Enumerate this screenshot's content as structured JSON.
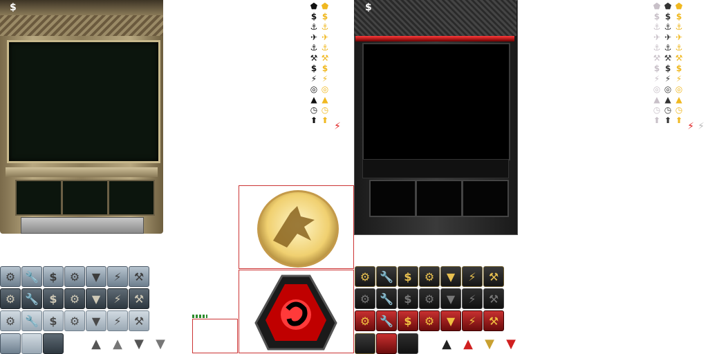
{
  "gdi_sidebar": {
    "currency_symbol": "$"
  },
  "nod_sidebar": {
    "currency_symbol": "$"
  },
  "icon_columns": {
    "black": [
      "⬟",
      "$",
      "⚓",
      "✈",
      "⚓",
      "⚒",
      "$",
      "⚡",
      "◎",
      "▲",
      "◷",
      "⬆"
    ],
    "gold": [
      "⬟",
      "$",
      "⚓",
      "✈",
      "⚓",
      "⚒",
      "$",
      "⚡",
      "◎",
      "▲",
      "◷",
      "⬆"
    ],
    "power_red": "⚡",
    "light": [
      "⬟",
      "$",
      "⚓",
      "✈",
      "⚓",
      "⚒",
      "$",
      "⚡",
      "◎",
      "▲",
      "◷",
      "⬆"
    ]
  },
  "buttons": {
    "icons": [
      "⚙",
      "🔧",
      "$",
      "⚙",
      "▼",
      "⚡",
      "⚒"
    ]
  },
  "arrows": [
    "▲",
    "▲",
    "▼",
    "▼"
  ],
  "colors": {
    "gdi_gold": "#f0b820",
    "nod_red": "#e02020",
    "frame_tan": "#b8a880"
  }
}
